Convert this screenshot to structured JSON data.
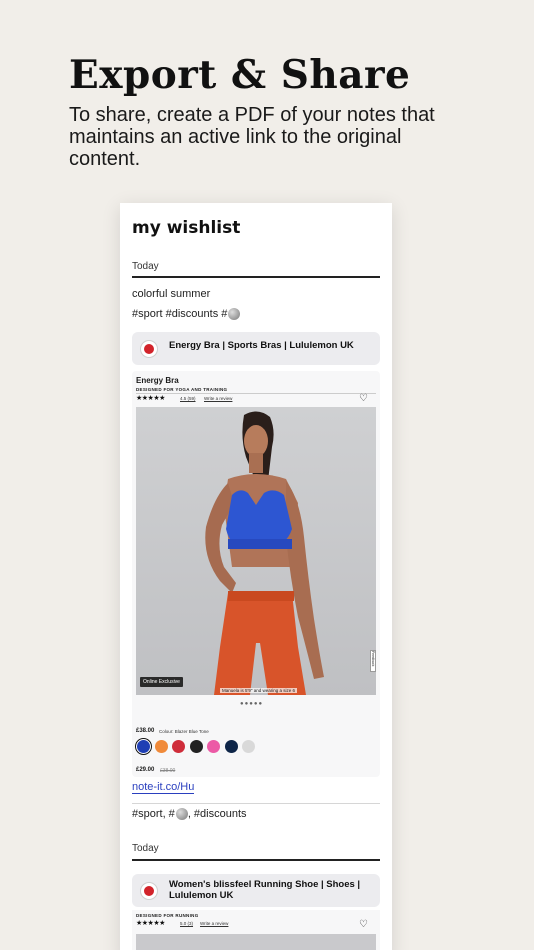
{
  "hero": {
    "title": "Export & Share",
    "subtitle": "To share, create a PDF of your notes that maintains an active link to the original content."
  },
  "note": {
    "title": "my wishlist",
    "sections": [
      {
        "date": "Today",
        "text": "colorful summer",
        "tags": "#sport #discounts #",
        "card": {
          "title": "Energy Bra | Sports Bras | Lululemon UK",
          "product": {
            "name": "Energy Bra",
            "tagline": "DESIGNED FOR YOGA AND TRAINING",
            "stars": "★★★★★",
            "rating": "4.5 (59)",
            "write_review": "Write a review",
            "badge": "Online Exclusive",
            "model_caption": "Manuela is 5'9\" and wearing a size 6",
            "feedback": "Feedback",
            "carousel_dots": "●●●●●",
            "price": "£38.00",
            "colour_label": "Colour: Blazer Blue Tone",
            "sale_price": "£29.00",
            "original_price": "£38.00",
            "swatch_colors": [
              "#1f3fb4",
              "#f08a3a",
              "#cf2d3a",
              "#222222",
              "#ec5aa6",
              "#0e2548",
              "#d9d9d9"
            ]
          }
        },
        "short_link": "note-it.co/Hu",
        "footer_tags_a": "#sport, #",
        "footer_tags_b": ", #discounts"
      },
      {
        "date": "Today",
        "card": {
          "title": "Women's blissfeel Running Shoe | Shoes | Lululemon UK",
          "product": {
            "tagline": "DESIGNED FOR RUNNING",
            "stars": "★★★★★",
            "rating": "5.0 (3)",
            "write_review": "Write a review"
          }
        }
      }
    ]
  },
  "colors": {
    "background": "#f1eee9",
    "link": "#2a3fbf",
    "brand_red": "#d2232a",
    "bra_blue": "#2d56d2",
    "leggings_orange": "#d8542a"
  }
}
